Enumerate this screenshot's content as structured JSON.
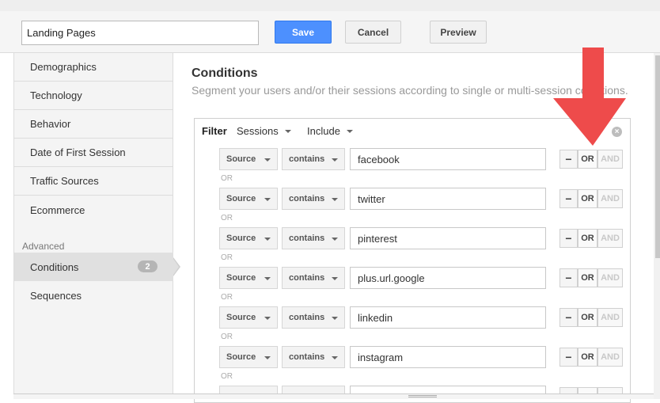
{
  "toolbar": {
    "segment_name": "Landing Pages",
    "save_label": "Save",
    "cancel_label": "Cancel",
    "preview_label": "Preview"
  },
  "sidebar": {
    "items": [
      {
        "label": "Demographics"
      },
      {
        "label": "Technology"
      },
      {
        "label": "Behavior"
      },
      {
        "label": "Date of First Session"
      },
      {
        "label": "Traffic Sources"
      },
      {
        "label": "Ecommerce"
      }
    ],
    "advanced_label": "Advanced",
    "conditions": {
      "label": "Conditions",
      "badge": "2"
    },
    "sequences_label": "Sequences"
  },
  "content": {
    "title": "Conditions",
    "subtitle": "Segment your users and/or their sessions according to single or multi-session conditions."
  },
  "filter": {
    "label": "Filter",
    "scope": "Sessions",
    "mode": "Include",
    "remove_symbol": "×"
  },
  "conditions": [
    {
      "dimension": "Source",
      "operator": "contains",
      "value": "facebook"
    },
    {
      "dimension": "Source",
      "operator": "contains",
      "value": "twitter"
    },
    {
      "dimension": "Source",
      "operator": "contains",
      "value": "pinterest"
    },
    {
      "dimension": "Source",
      "operator": "contains",
      "value": "plus.url.google"
    },
    {
      "dimension": "Source",
      "operator": "contains",
      "value": "linkedin"
    },
    {
      "dimension": "Source",
      "operator": "contains",
      "value": "instagram"
    }
  ],
  "or_separator": "OR",
  "toggle": {
    "minus": "−",
    "or": "OR",
    "and": "AND"
  },
  "colors": {
    "save_button": "#4d90fe",
    "annotation_arrow": "#ee4b4b"
  }
}
